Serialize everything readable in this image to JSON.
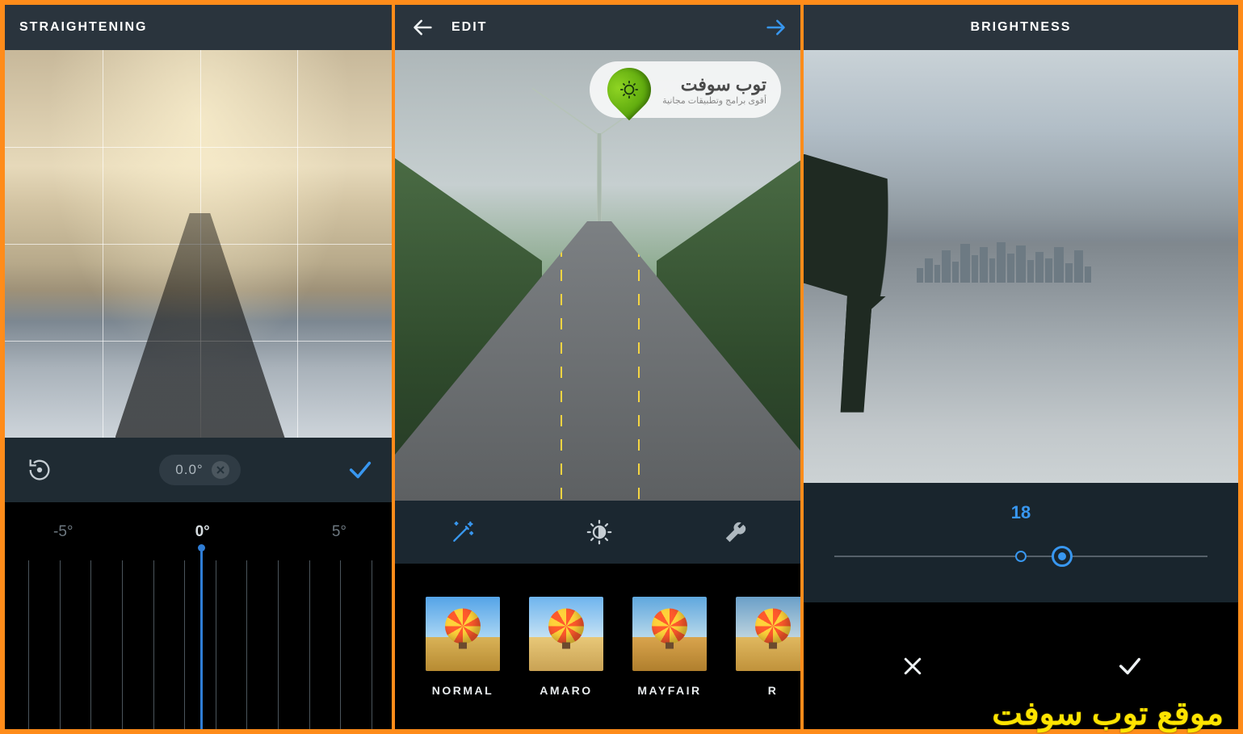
{
  "frame_color": "#ff8c1a",
  "accent_color": "#3897f0",
  "panel1": {
    "title": "STRAIGHTENING",
    "angle_value": "0.0°",
    "ruler_labels": {
      "left": "-5°",
      "center": "0°",
      "right": "5°"
    }
  },
  "panel2": {
    "title": "EDIT",
    "logo_brand": "توب سوفت",
    "logo_tagline": "أقوى برامج وتطبيقات مجانية",
    "filters": [
      {
        "label": "NORMAL",
        "variant": "flt-normal",
        "selected": true
      },
      {
        "label": "AMARO",
        "variant": "flt-amaro",
        "selected": false
      },
      {
        "label": "MAYFAIR",
        "variant": "flt-mayfair",
        "selected": false
      },
      {
        "label": "R",
        "variant": "flt-rise",
        "selected": false
      }
    ]
  },
  "panel3": {
    "title": "BRIGHTNESS",
    "value": "18",
    "slider_percent": 61
  },
  "watermark": "موقع توب سوفت"
}
